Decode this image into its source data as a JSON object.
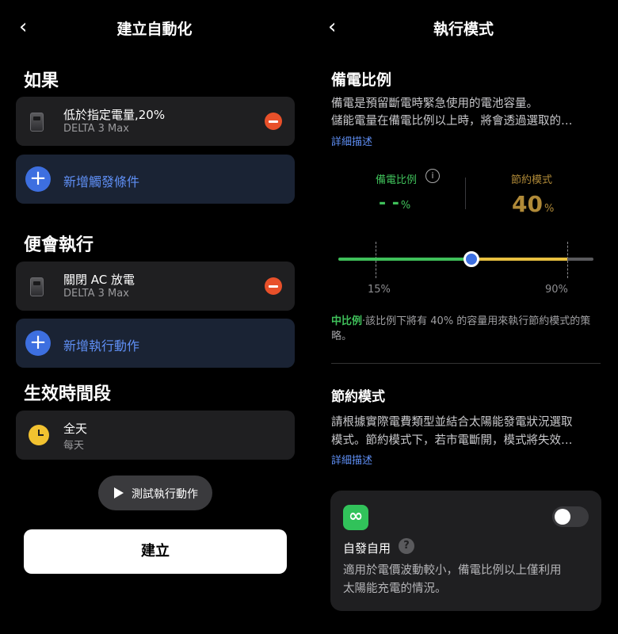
{
  "left": {
    "back_glyph": "‹",
    "title": "建立自動化",
    "if_section": "如果",
    "trigger": {
      "title": "低於指定電量,20%",
      "device": "DELTA 3 Max"
    },
    "add_trigger": "新增觸發條件",
    "then_section": "便會執行",
    "action": {
      "title": "關閉 AC 放電",
      "device": "DELTA 3 Max"
    },
    "add_action": "新增執行動作",
    "time_section": "生效時間段",
    "time": {
      "title": "全天",
      "sub": "每天"
    },
    "test_button": "測試執行動作",
    "create_button": "建立"
  },
  "right": {
    "back_glyph": "‹",
    "title": "執行模式",
    "backup_heading": "備電比例",
    "backup_desc_line1": "備電是預留斷電時緊急使用的電池容量。",
    "backup_desc_line2": "儲能電量在備電比例以上時，將會透過選取的…",
    "detail_link": "詳細描述",
    "backup_label": "備電比例",
    "backup_value": "- -",
    "saving_label": "節約模式",
    "saving_value": "40",
    "percent_sign": "%",
    "slider": {
      "min_label": "15%",
      "max_label": "90%",
      "value_fraction": 0.5
    },
    "note_highlight": "中比例",
    "note_text": "·該比例下將有 40% 的容量用來執行節約模式的策略。",
    "saving_heading": "節約模式",
    "saving_desc_line1": "請根據實際電費類型並結合太陽能發電狀況選取",
    "saving_desc_line2": "模式。節約模式下，若市電斷開，模式將失效…",
    "detail_link2": "詳細描述",
    "mode_card": {
      "title": "自發自用",
      "desc_line1": "適用於電價波動較小，備電比例以上僅利用",
      "desc_line2": "太陽能充電的情況。",
      "toggle_on": false
    }
  },
  "colors": {
    "accent_blue": "#3d6fe0",
    "link_blue": "#5f8ff5",
    "green": "#3fc05a",
    "gold": "#b08a38",
    "danger": "#e8502a",
    "clock_yellow": "#f2c230"
  }
}
